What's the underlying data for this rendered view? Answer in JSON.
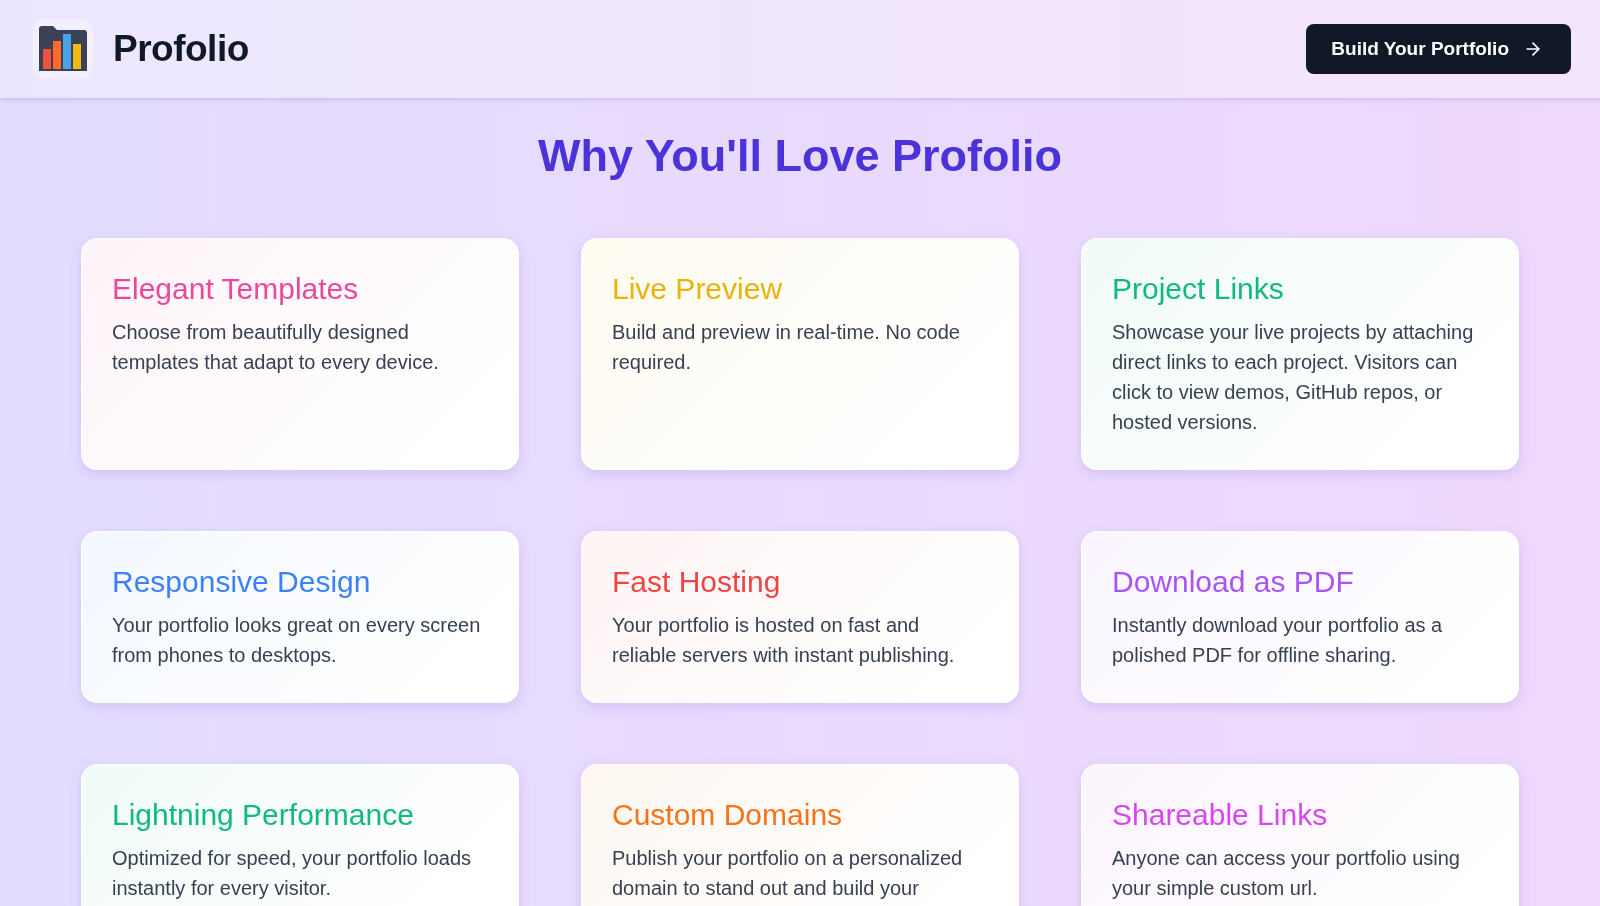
{
  "header": {
    "logo_text": "Profolio",
    "cta_button": "Build Your Portfolio"
  },
  "section": {
    "title": "Why You'll Love Profolio"
  },
  "cards": [
    {
      "title": "Elegant Templates",
      "text": "Choose from beautifully designed templates that adapt to every device.",
      "color": "#ec4899"
    },
    {
      "title": "Live Preview",
      "text": "Build and preview in real-time. No code required.",
      "color": "#eab308"
    },
    {
      "title": "Project Links",
      "text": "Showcase your live projects by attaching direct links to each project. Visitors can click to view demos, GitHub repos, or hosted versions.",
      "color": "#10b981"
    },
    {
      "title": "Responsive Design",
      "text": "Your portfolio looks great on every screen from phones to desktops.",
      "color": "#3b82f6"
    },
    {
      "title": "Fast Hosting",
      "text": "Your portfolio is hosted on fast and reliable servers with instant publishing.",
      "color": "#ef4444"
    },
    {
      "title": "Download as PDF",
      "text": "Instantly download your portfolio as a polished PDF for offline sharing.",
      "color": "#a855f7"
    },
    {
      "title": "Lightning Performance",
      "text": "Optimized for speed, your portfolio loads instantly for every visitor.",
      "color": "#10b981"
    },
    {
      "title": "Custom Domains",
      "text": "Publish your portfolio on a personalized domain to stand out and build your",
      "color": "#f97316"
    },
    {
      "title": "Shareable Links",
      "text": "Anyone can access your portfolio using your simple custom url.",
      "color": "#d946ef"
    }
  ]
}
